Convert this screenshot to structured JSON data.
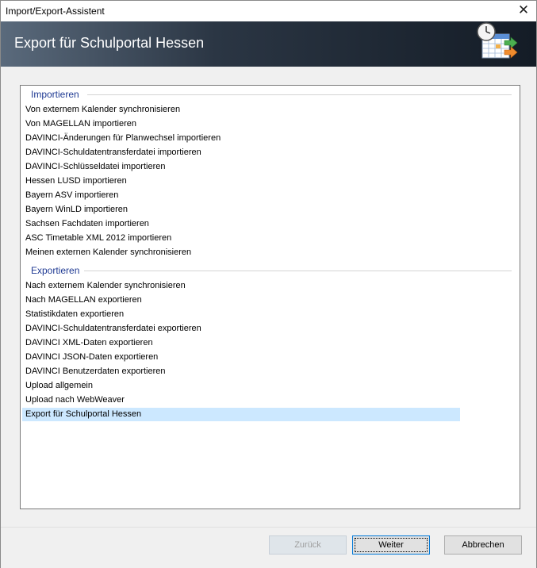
{
  "window": {
    "title": "Import/Export-Assistent",
    "close_glyph": "✕"
  },
  "banner": {
    "title": "Export für Schulportal Hessen",
    "icon": "calendar-clock-export-icon"
  },
  "groups": [
    {
      "header": "Importieren",
      "items": [
        "Von externem Kalender synchronisieren",
        "Von MAGELLAN importieren",
        "DAVINCI-Änderungen für Planwechsel importieren",
        "DAVINCI-Schuldatentransferdatei importieren",
        "DAVINCI-Schlüsseldatei importieren",
        "Hessen LUSD importieren",
        "Bayern ASV importieren",
        "Bayern WinLD importieren",
        "Sachsen Fachdaten importieren",
        "ASC Timetable XML 2012 importieren",
        "Meinen externen Kalender synchronisieren"
      ]
    },
    {
      "header": "Exportieren",
      "items": [
        "Nach externem Kalender synchronisieren",
        "Nach MAGELLAN exportieren",
        "Statistikdaten exportieren",
        "DAVINCI-Schuldatentransferdatei exportieren",
        "DAVINCI XML-Daten exportieren",
        "DAVINCI JSON-Daten exportieren",
        "DAVINCI Benutzerdaten exportieren",
        "Upload allgemein",
        "Upload nach WebWeaver",
        "Export für Schulportal Hessen"
      ]
    }
  ],
  "selected_item": "Export für Schulportal Hessen",
  "buttons": {
    "back": "Zurück",
    "next": "Weiter",
    "cancel": "Abbrechen"
  },
  "colors": {
    "accent": "#0078d7",
    "group_header": "#1f3a93",
    "selection": "#cce8ff"
  }
}
